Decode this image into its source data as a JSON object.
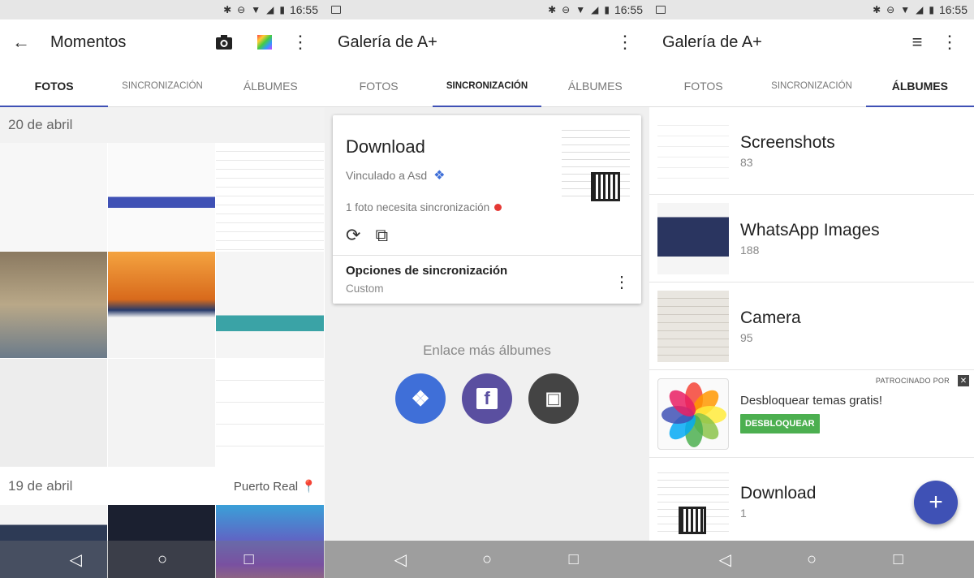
{
  "status": {
    "time": "16:55"
  },
  "screen1": {
    "title": "Momentos",
    "tabs": [
      "FOTOS",
      "SINCRONIZACIÓN",
      "ÁLBUMES"
    ],
    "sections": [
      {
        "date": "20 de abril",
        "location": ""
      },
      {
        "date": "19 de abril",
        "location": "Puerto Real"
      }
    ]
  },
  "screen2": {
    "title": "Galería de A+",
    "tabs": [
      "FOTOS",
      "SINCRONIZACIÓN",
      "ÁLBUMES"
    ],
    "card": {
      "title": "Download",
      "linked": "Vinculado a Asd",
      "needs_sync": "1 foto necesita sincronización",
      "options_title": "Opciones de sincronización",
      "options_value": "Custom"
    },
    "link_more": "Enlace más álbumes",
    "services": [
      {
        "name": "dropbox",
        "color": "#3f6fd8"
      },
      {
        "name": "facebook",
        "color": "#5a4fa0"
      },
      {
        "name": "amazon",
        "color": "#444444"
      }
    ]
  },
  "screen3": {
    "title": "Galería de A+",
    "tabs": [
      "FOTOS",
      "SINCRONIZACIÓN",
      "ÁLBUMES"
    ],
    "albums": [
      {
        "name": "Screenshots",
        "count": "83"
      },
      {
        "name": "WhatsApp Images",
        "count": "188"
      },
      {
        "name": "Camera",
        "count": "95"
      }
    ],
    "ad": {
      "label": "PATROCINADO POR",
      "title": "Desbloquear temas gratis!",
      "button": "DESBLOQUEAR"
    },
    "album_last": {
      "name": "Download",
      "count": "1"
    }
  },
  "colors": {
    "accent": "#3f51b5",
    "ad_button": "#4caf50",
    "nav_bar": "#9e9e9e"
  }
}
